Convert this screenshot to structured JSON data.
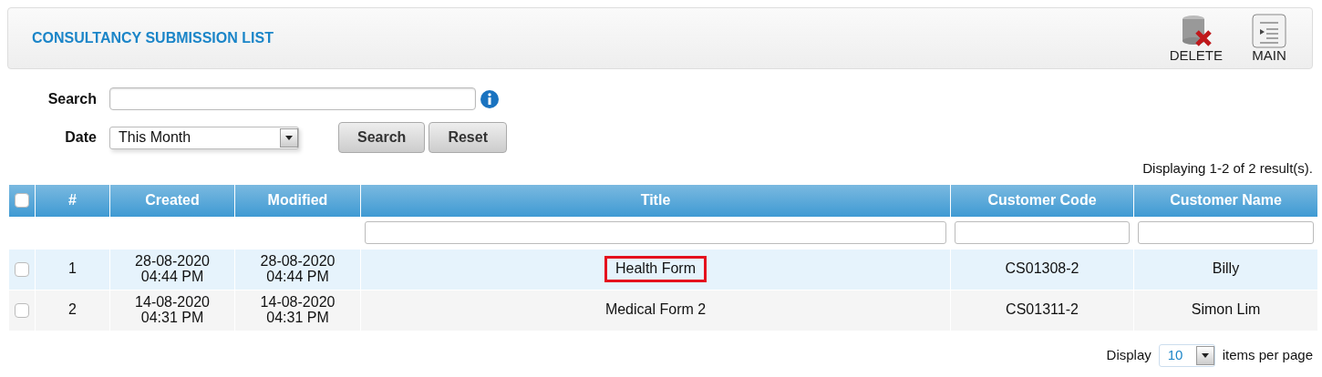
{
  "header": {
    "title": "CONSULTANCY SUBMISSION LIST",
    "actions": [
      {
        "kind": "delete",
        "label": "DELETE"
      },
      {
        "kind": "main",
        "label": "MAIN"
      }
    ]
  },
  "search": {
    "label": "Search",
    "button": "Search",
    "reset": "Reset"
  },
  "date": {
    "label": "Date",
    "value": "This Month"
  },
  "summary": "Displaying 1-2 of 2 result(s).",
  "table": {
    "select_all": {
      "checked": false
    },
    "columns": [
      {
        "label": "#",
        "filter": false
      },
      {
        "label": "Created",
        "filter": false
      },
      {
        "label": "Modified",
        "filter": false
      },
      {
        "label": "Title",
        "filter": true
      },
      {
        "label": "Customer Code",
        "filter": true
      },
      {
        "label": "Customer Name",
        "filter": true
      }
    ],
    "rows": [
      {
        "checked": false,
        "cells": [
          "1",
          "28-08-2020\n04:44 PM",
          "28-08-2020\n04:44 PM",
          "Health Form",
          "CS01308-2",
          "Billy"
        ],
        "title_outlined": true
      },
      {
        "checked": false,
        "cells": [
          "2",
          "14-08-2020\n04:31 PM",
          "14-08-2020\n04:31 PM",
          "Medical Form 2",
          "CS01311-2",
          "Simon Lim"
        ],
        "title_outlined": false
      }
    ]
  },
  "pager": {
    "before": "Display",
    "value": "10",
    "after": "items per page"
  }
}
